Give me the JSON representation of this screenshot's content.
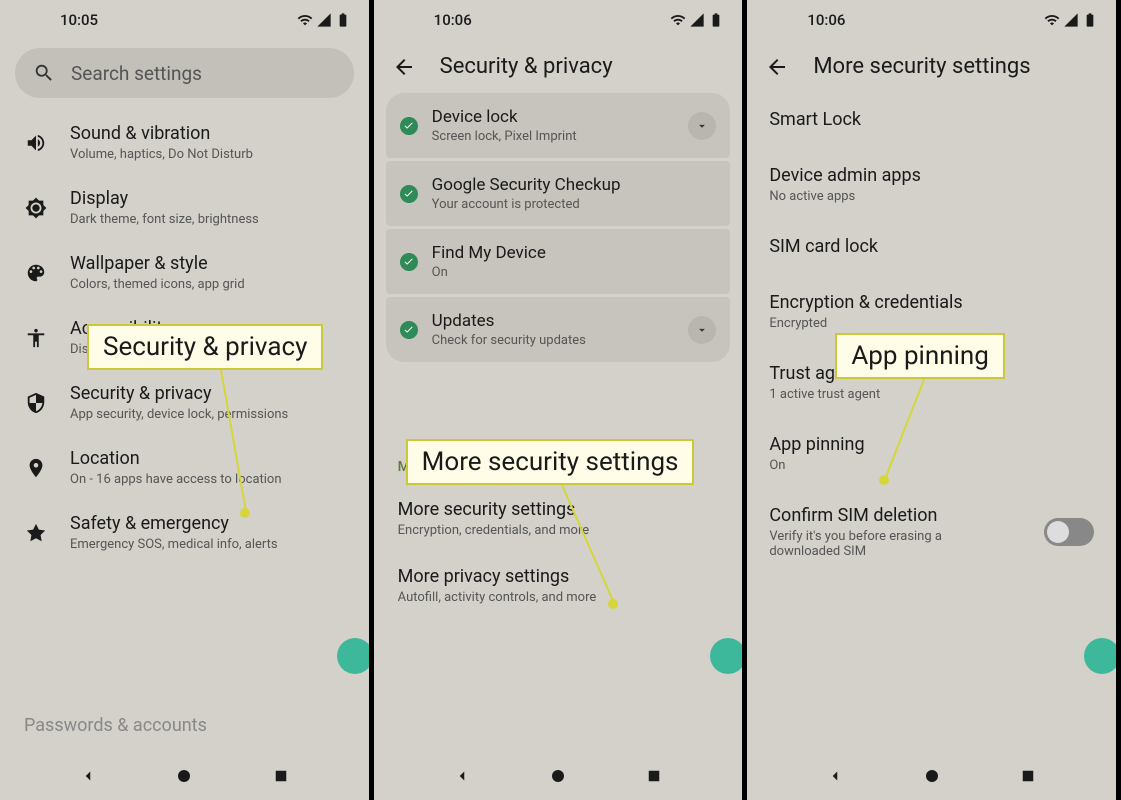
{
  "screens": {
    "settings": {
      "time": "10:05",
      "search_placeholder": "Search settings",
      "items": [
        {
          "title": "Sound & vibration",
          "sub": "Volume, haptics, Do Not Disturb"
        },
        {
          "title": "Display",
          "sub": "Dark theme, font size, brightness"
        },
        {
          "title": "Wallpaper & style",
          "sub": "Colors, themed icons, app grid"
        },
        {
          "title": "Accessibility",
          "sub": "Display, interaction, audio"
        },
        {
          "title": "Security & privacy",
          "sub": "App security, device lock, permissions"
        },
        {
          "title": "Location",
          "sub": "On - 16 apps have access to location"
        },
        {
          "title": "Safety & emergency",
          "sub": "Emergency SOS, medical info, alerts"
        },
        {
          "title": "Passwords & accounts",
          "sub": ""
        }
      ],
      "callout": "Security & privacy"
    },
    "security": {
      "time": "10:06",
      "header": "Security & privacy",
      "cards": [
        {
          "title": "Device lock",
          "sub": "Screen lock, Pixel Imprint",
          "expand": true
        },
        {
          "title": "Google Security Checkup",
          "sub": "Your account is protected",
          "expand": false
        },
        {
          "title": "Find My Device",
          "sub": "On",
          "expand": false
        },
        {
          "title": "Updates",
          "sub": "Check for security updates",
          "expand": true
        }
      ],
      "section_label": "More settings",
      "sub_items": [
        {
          "title": "More security settings",
          "sub": "Encryption, credentials, and more"
        },
        {
          "title": "More privacy settings",
          "sub": "Autofill, activity controls, and more"
        }
      ],
      "callout": "More security settings"
    },
    "more": {
      "time": "10:06",
      "header": "More security settings",
      "items": [
        {
          "title": "Smart Lock",
          "sub": ""
        },
        {
          "title": "Device admin apps",
          "sub": "No active apps"
        },
        {
          "title": "SIM card lock",
          "sub": ""
        },
        {
          "title": "Encryption & credentials",
          "sub": "Encrypted"
        },
        {
          "title": "Trust agents",
          "sub": "1 active trust agent"
        },
        {
          "title": "App pinning",
          "sub": "On"
        },
        {
          "title": "Confirm SIM deletion",
          "sub": "Verify it's you before erasing a downloaded SIM"
        }
      ],
      "callout": "App pinning"
    }
  }
}
